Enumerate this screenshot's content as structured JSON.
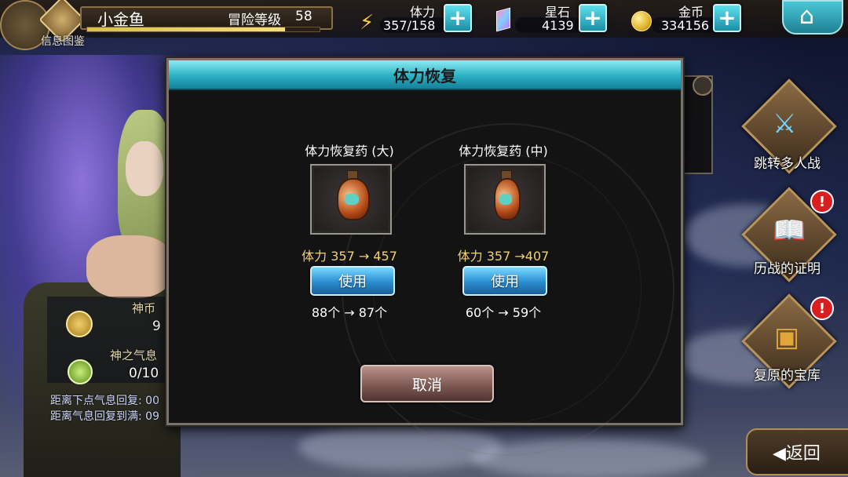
{
  "player": {
    "name": "小金鱼",
    "level_label": "冒险等级",
    "level": "58",
    "info_label": "信息图鉴",
    "exp_fraction": 0.85
  },
  "resources": {
    "stamina": {
      "label": "体力",
      "value": "357/158",
      "icon": "lightning-bolt-icon"
    },
    "star_stone": {
      "label": "星石",
      "value": "4139",
      "icon": "crystal-gem-icon"
    },
    "gold": {
      "label": "金币",
      "value": "334156",
      "icon": "gold-coin-icon"
    }
  },
  "home_icon": "home-icon",
  "right_menu": [
    {
      "label": "跳转多人战",
      "icon": "crossed-swords-icon",
      "alert": false
    },
    {
      "label": "历战的证明",
      "icon": "open-book-icon",
      "alert": true,
      "alert_mark": "!"
    },
    {
      "label": "复原的宝库",
      "icon": "treasure-chest-icon",
      "alert": true,
      "alert_mark": "!"
    }
  ],
  "left_info": {
    "coin_label": "神币",
    "coin_value": "9",
    "breath_label": "神之气息",
    "breath_value": "0/10",
    "next_recover_label": "距离下点气息回复: 00",
    "full_recover_label": "距离气息回复到满: 09"
  },
  "back_button": {
    "label": "返回",
    "icon": "back-arrow-icon"
  },
  "dialog": {
    "title": "体力恢复",
    "items": [
      {
        "name": "体力恢复药 (大)",
        "stamina_change": "体力 357 → 457",
        "use_label": "使用",
        "count_change": "88个 → 87个"
      },
      {
        "name": "体力恢复药 (中)",
        "stamina_change": "体力 357 →407",
        "use_label": "使用",
        "count_change": "60个 → 59个"
      }
    ],
    "cancel_label": "取消"
  },
  "colors": {
    "accent_cyan": "#2bb0c3",
    "stamina_text": "#f0d36c",
    "alert_red": "#d81e1e"
  }
}
